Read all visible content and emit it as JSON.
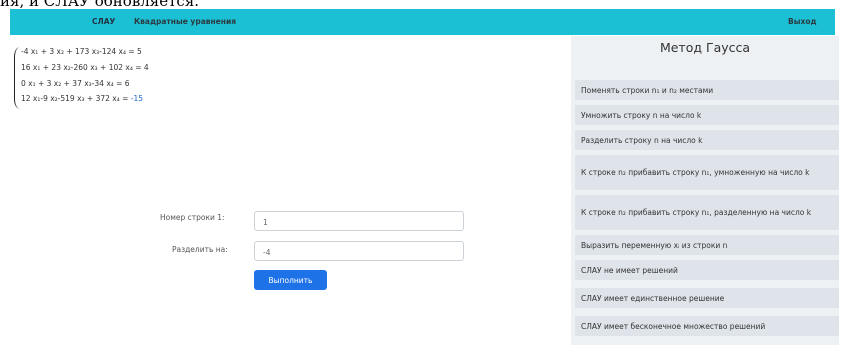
{
  "top_cut_text": "ия, и СЛАУ обновляется.",
  "navbar": {
    "brand": "СЛАУ",
    "link": "Квадратные уравнения",
    "exit": "Выход"
  },
  "system": {
    "equations": [
      "-4 x₁ + 3 x₂ + 173 x₃-124 x₄ = 5",
      "16 x₁ + 23 x₂-260 x₃ + 102 x₄ = 4",
      "0 x₁ + 3 x₂ + 37 x₃-34 x₄ = 6",
      "12 x₁-9 x₂-519 x₃ + 372 x₄ = "
    ],
    "last_rhs": "-15"
  },
  "form": {
    "row_label": "Номер строки 1:",
    "row_value": "1",
    "divide_label": "Разделить на:",
    "divide_value": "-4",
    "run_button": "Выполнить"
  },
  "sidebar": {
    "title": "Метод Гаусса",
    "buttons": [
      "Поменять строки n₁ и n₂ местами",
      "Умножить строку n на число k",
      "Разделить строку n на число k",
      "К строке n₂ прибавить строку n₁, умноженную на число k",
      "К строке n₂ прибавить строку n₁, разделенную на число k",
      "Выразить переменную xᵢ из строки n",
      "СЛАУ не имеет решений",
      "СЛАУ имеет единственное решение",
      "СЛАУ имеет бесконечное множество решений"
    ]
  }
}
